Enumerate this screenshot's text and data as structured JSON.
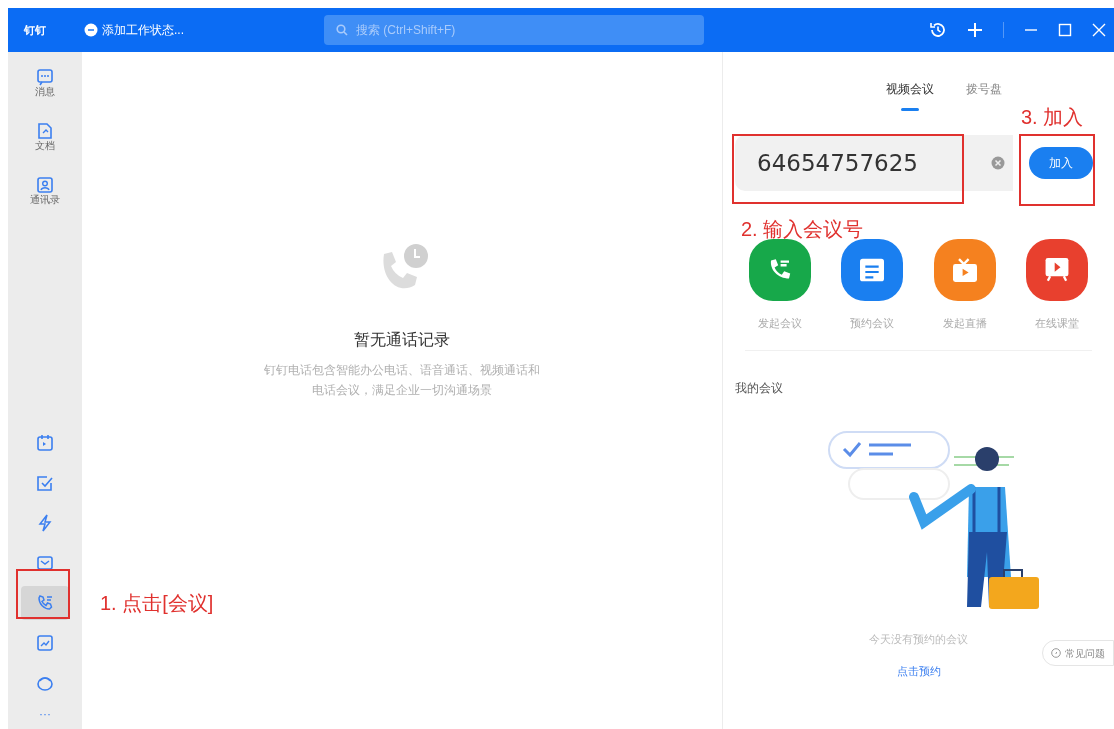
{
  "title_bar": {
    "logo": "钉钉",
    "status": "添加工作状态...",
    "search": {
      "placeholder": "搜索 (Ctrl+Shift+F)"
    }
  },
  "sidebar": {
    "top_items": [
      {
        "label": "消息",
        "selected": false
      },
      {
        "label": "文档",
        "selected": false
      },
      {
        "label": "通讯录",
        "selected": false
      }
    ],
    "bottom_items": [
      {
        "kind": "calendar",
        "selected": false
      },
      {
        "kind": "todo",
        "selected": false
      },
      {
        "kind": "flash",
        "selected": false
      },
      {
        "kind": "mail",
        "selected": false
      },
      {
        "kind": "meeting",
        "selected": true
      },
      {
        "kind": "form",
        "selected": false
      },
      {
        "kind": "box",
        "selected": false
      }
    ],
    "more": "···"
  },
  "call_log": {
    "title": "暂无通话记录",
    "description": "钉钉电话包含智能办公电话、语音通话、视频通话和电话会议，满足企业一切沟通场景"
  },
  "meeting": {
    "tabs": [
      {
        "label": "视频会议",
        "selected": true
      },
      {
        "label": "拨号盘",
        "selected": false
      }
    ],
    "meeting_number": {
      "value": "64654757625"
    },
    "join_button": "加入",
    "actions": [
      {
        "label": "发起会议",
        "color": "#17a84a",
        "kind": "call"
      },
      {
        "label": "预约会议",
        "color": "#1a7ff0",
        "kind": "calendar"
      },
      {
        "label": "发起直播",
        "color": "#f5811f",
        "kind": "live"
      },
      {
        "label": "在线课堂",
        "color": "#e8402e",
        "kind": "class"
      }
    ],
    "my_meetings_title": "我的会议",
    "empty_text": "今天没有预约的会议",
    "schedule_link": "点击预约",
    "help": "常见问题"
  },
  "annotations": [
    {
      "text": "1. 点击[会议]"
    },
    {
      "text": "2. 输入会议号"
    },
    {
      "text": "3. 加入"
    }
  ]
}
